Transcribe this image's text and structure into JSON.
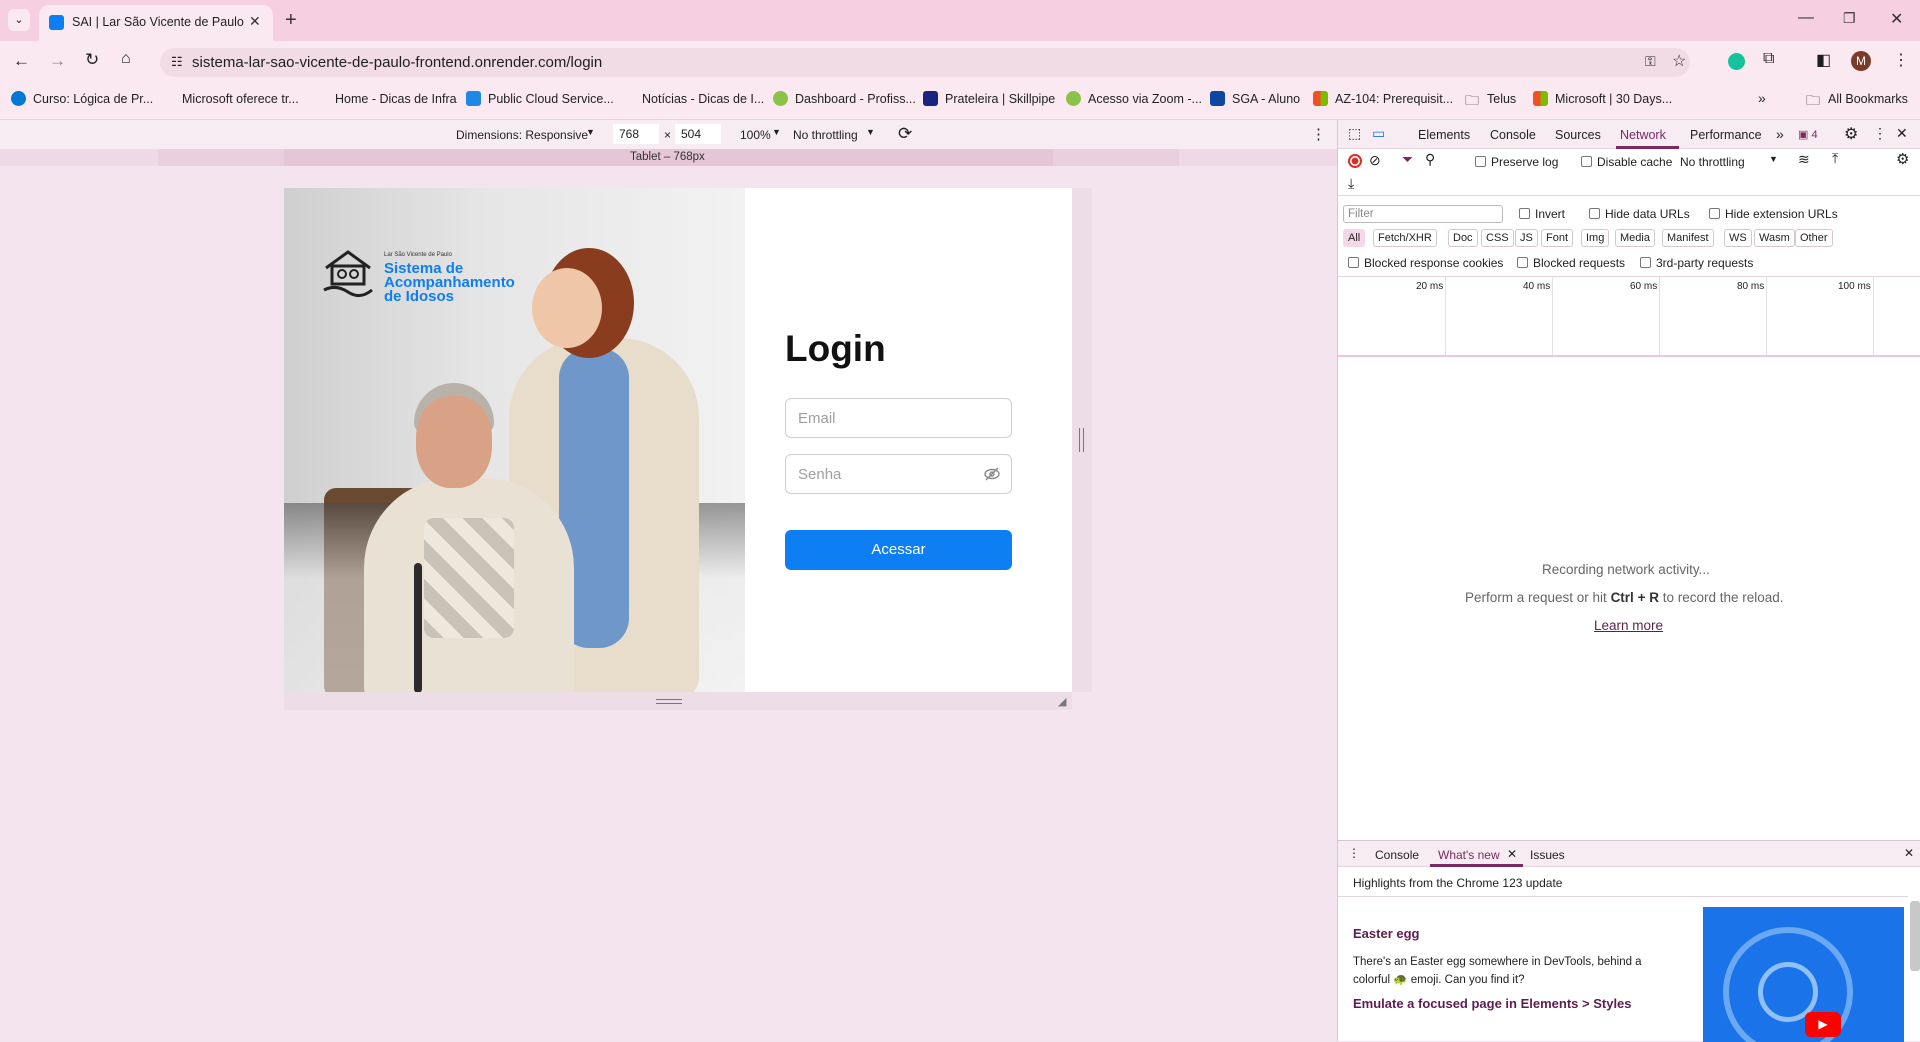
{
  "browser": {
    "tab_title": "SAI | Lar São Vicente de Paulo",
    "url": "sistema-lar-sao-vicente-de-paulo-frontend.onrender.com/login",
    "profile_initial": "M",
    "all_bookmarks": "All Bookmarks",
    "bookmarks": [
      "Curso: Lógica de Pr...",
      "Microsoft oferece tr...",
      "Home - Dicas de Infra",
      "Public Cloud Service...",
      "Notícias - Dicas de I...",
      "Dashboard - Profiss...",
      "Prateleira | Skillpipe",
      "Acesso via Zoom -...",
      "SGA - Aluno",
      "AZ-104: Prerequisit...",
      "Telus",
      "Microsoft | 30 Days..."
    ]
  },
  "device_toolbar": {
    "dimensions": "Dimensions: Responsive",
    "width": "768",
    "times": "×",
    "height": "504",
    "zoom": "100%",
    "throttle": "No throttling",
    "media_label": "Tablet – 768px"
  },
  "app": {
    "brand_small": "Lar São Vicente de Paulo",
    "brand_line1": "Sistema de",
    "brand_line2": "Acompanhamento",
    "brand_line3": "de Idosos",
    "login_title": "Login",
    "email_placeholder": "Email",
    "password_placeholder": "Senha",
    "submit_label": "Acessar"
  },
  "devtools": {
    "tabs": [
      "Elements",
      "Console",
      "Sources",
      "Network",
      "Performance"
    ],
    "active_tab": "Network",
    "issues_count": "4",
    "preserve_log": "Preserve log",
    "disable_cache": "Disable cache",
    "no_throttling": "No throttling",
    "filter_placeholder": "Filter",
    "invert": "Invert",
    "hide_data_urls": "Hide data URLs",
    "hide_extension_urls": "Hide extension URLs",
    "type_filters": [
      "All",
      "Fetch/XHR",
      "Doc",
      "CSS",
      "JS",
      "Font",
      "Img",
      "Media",
      "Manifest",
      "WS",
      "Wasm",
      "Other"
    ],
    "blocked_response_cookies": "Blocked response cookies",
    "blocked_requests": "Blocked requests",
    "third_party": "3rd-party requests",
    "timeline_ticks": [
      "20 ms",
      "40 ms",
      "60 ms",
      "80 ms",
      "100 ms"
    ],
    "recording": "Recording network activity...",
    "perform_a": "Perform a request or hit ",
    "perform_keys": "Ctrl + R",
    "perform_b": " to record the reload.",
    "learn_more": "Learn more",
    "drawer_tabs": [
      "Console",
      "What's new",
      "Issues"
    ],
    "highlights": "Highlights from the Chrome 123 update",
    "easter_title": "Easter egg",
    "easter_body": "There's an Easter egg somewhere in DevTools, behind a colorful 🐢 emoji. Can you find it?",
    "emulate_title": "Emulate a focused page in Elements > Styles"
  }
}
